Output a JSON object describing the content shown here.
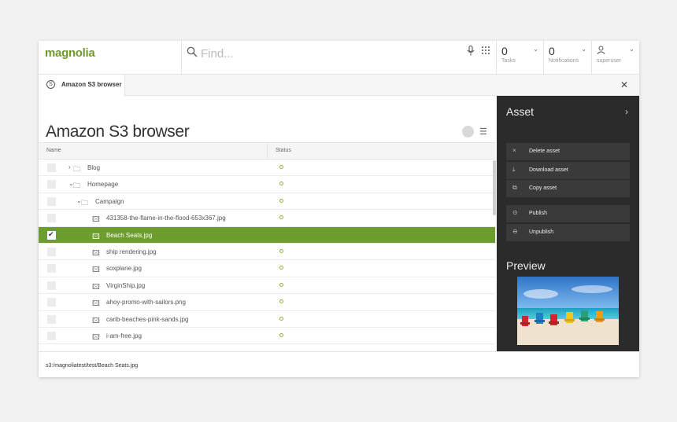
{
  "header": {
    "logo": "magnolia",
    "search_placeholder": "Find...",
    "tasks": {
      "count": "0",
      "label": "Tasks"
    },
    "notifications": {
      "count": "0",
      "label": "Notifications"
    },
    "user": {
      "label": "superuser"
    }
  },
  "tab": {
    "label": "Amazon S3 browser",
    "icon_letter": "S"
  },
  "main": {
    "title": "Amazon S3 browser",
    "columns": {
      "name": "Name",
      "status": "Status"
    },
    "rows": [
      {
        "name": "Blog",
        "type": "folder",
        "twisty": "›",
        "level": 0,
        "status": true,
        "selected": false
      },
      {
        "name": "Homepage",
        "type": "folder",
        "twisty": "⌄",
        "level": 0,
        "status": true,
        "selected": false
      },
      {
        "name": "Campaign",
        "type": "folder",
        "twisty": "⌄",
        "level": 1,
        "status": true,
        "selected": false
      },
      {
        "name": "431358-the-flame-in-the-flood-653x367.jpg",
        "type": "image",
        "level": 2,
        "status": true,
        "selected": false
      },
      {
        "name": "Beach Seats.jpg",
        "type": "image",
        "level": 2,
        "status": false,
        "selected": true
      },
      {
        "name": "ship rendering.jpg",
        "type": "image",
        "level": 2,
        "status": true,
        "selected": false
      },
      {
        "name": "soxplane.jpg",
        "type": "image",
        "level": 2,
        "status": true,
        "selected": false
      },
      {
        "name": "VirginShip.jpg",
        "type": "image",
        "level": 2,
        "status": true,
        "selected": false
      },
      {
        "name": "ahoy-promo-with-sailors.png",
        "type": "image",
        "level": 2,
        "status": true,
        "selected": false
      },
      {
        "name": "carib-beaches-pink-sands.jpg",
        "type": "image",
        "level": 2,
        "status": true,
        "selected": false
      },
      {
        "name": "i-am-free.jpg",
        "type": "image",
        "level": 2,
        "status": true,
        "selected": false
      }
    ]
  },
  "footer": {
    "path": "s3:/magnoliatest/test/Beach Seats.jpg"
  },
  "actionbar": {
    "title": "Asset",
    "group1": [
      {
        "icon": "×",
        "icon_name": "close-icon",
        "label": "Delete asset"
      },
      {
        "icon": "⤓",
        "icon_name": "download-icon",
        "label": "Download asset"
      },
      {
        "icon": "⧉",
        "icon_name": "copy-icon",
        "label": "Copy asset"
      }
    ],
    "group2": [
      {
        "icon": "⊙",
        "icon_name": "publish-icon",
        "label": "Publish"
      },
      {
        "icon": "⊖",
        "icon_name": "unpublish-icon",
        "label": "Unpublish"
      }
    ],
    "preview_title": "Preview"
  },
  "colors": {
    "accent": "#6c9d2d",
    "actionbar_bg": "#2b2b2b"
  }
}
